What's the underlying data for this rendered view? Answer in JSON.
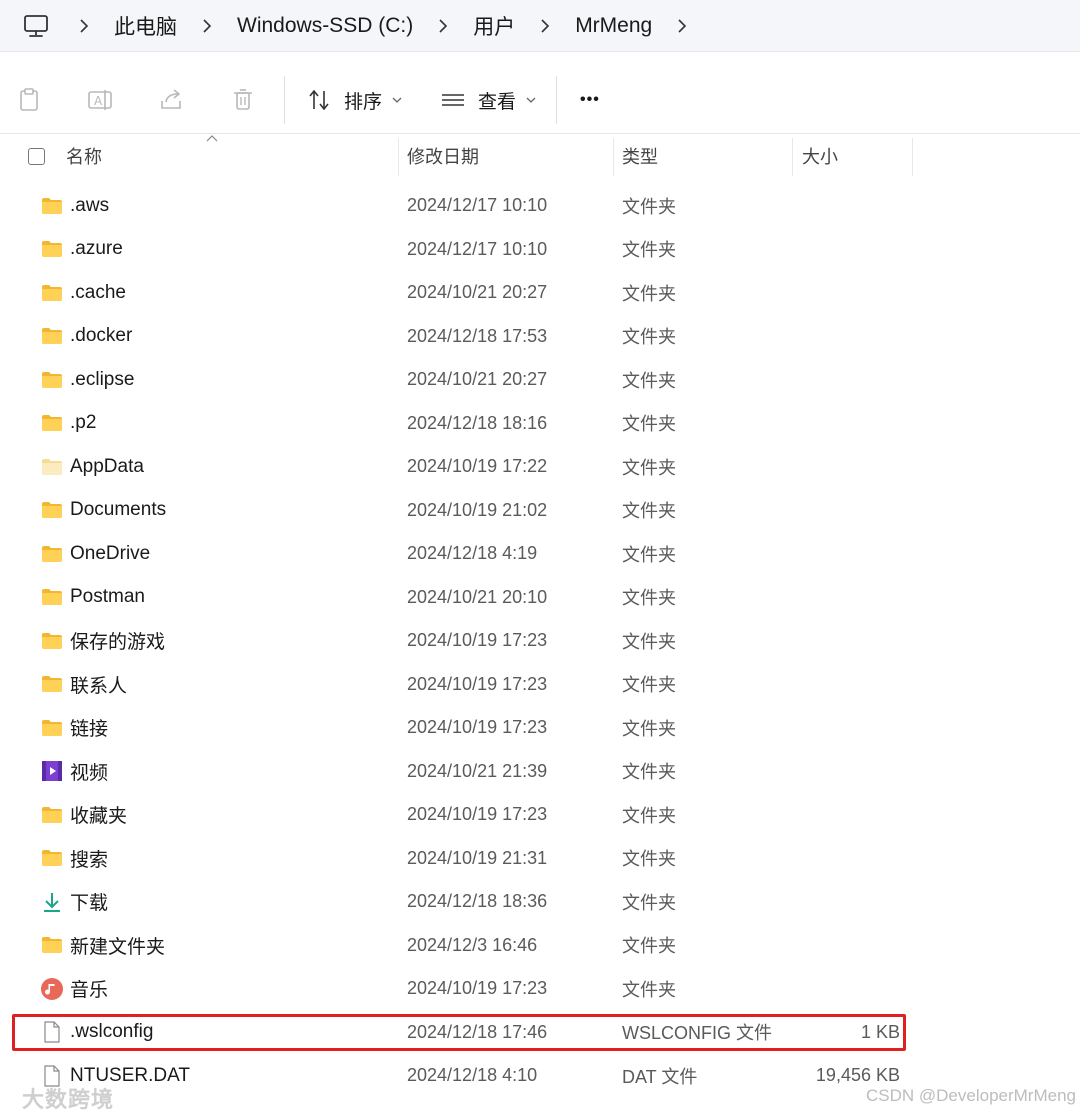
{
  "address": {
    "crumbs": [
      "此电脑",
      "Windows-SSD (C:)",
      "用户",
      "MrMeng"
    ]
  },
  "toolbar": {
    "sort_label": "排序",
    "view_label": "查看",
    "more_label": "•••"
  },
  "columns": {
    "name": "名称",
    "date": "修改日期",
    "type": "类型",
    "size": "大小"
  },
  "files": [
    {
      "name": ".aws",
      "date": "2024/12/17 10:10",
      "type": "文件夹",
      "size": "",
      "icon": "folder-icon"
    },
    {
      "name": ".azure",
      "date": "2024/12/17 10:10",
      "type": "文件夹",
      "size": "",
      "icon": "folder-icon"
    },
    {
      "name": ".cache",
      "date": "2024/10/21 20:27",
      "type": "文件夹",
      "size": "",
      "icon": "folder-icon"
    },
    {
      "name": ".docker",
      "date": "2024/12/18 17:53",
      "type": "文件夹",
      "size": "",
      "icon": "folder-icon"
    },
    {
      "name": ".eclipse",
      "date": "2024/10/21 20:27",
      "type": "文件夹",
      "size": "",
      "icon": "folder-icon"
    },
    {
      "name": ".p2",
      "date": "2024/12/18 18:16",
      "type": "文件夹",
      "size": "",
      "icon": "folder-icon"
    },
    {
      "name": "AppData",
      "date": "2024/10/19 17:22",
      "type": "文件夹",
      "size": "",
      "icon": "hidden-folder-icon"
    },
    {
      "name": "Documents",
      "date": "2024/10/19 21:02",
      "type": "文件夹",
      "size": "",
      "icon": "folder-icon"
    },
    {
      "name": "OneDrive",
      "date": "2024/12/18 4:19",
      "type": "文件夹",
      "size": "",
      "icon": "folder-icon"
    },
    {
      "name": "Postman",
      "date": "2024/10/21 20:10",
      "type": "文件夹",
      "size": "",
      "icon": "folder-icon"
    },
    {
      "name": "保存的游戏",
      "date": "2024/10/19 17:23",
      "type": "文件夹",
      "size": "",
      "icon": "folder-icon"
    },
    {
      "name": "联系人",
      "date": "2024/10/19 17:23",
      "type": "文件夹",
      "size": "",
      "icon": "folder-icon"
    },
    {
      "name": "链接",
      "date": "2024/10/19 17:23",
      "type": "文件夹",
      "size": "",
      "icon": "folder-icon"
    },
    {
      "name": "视频",
      "date": "2024/10/21 21:39",
      "type": "文件夹",
      "size": "",
      "icon": "video-icon"
    },
    {
      "name": "收藏夹",
      "date": "2024/10/19 17:23",
      "type": "文件夹",
      "size": "",
      "icon": "folder-icon"
    },
    {
      "name": "搜索",
      "date": "2024/10/19 21:31",
      "type": "文件夹",
      "size": "",
      "icon": "folder-icon"
    },
    {
      "name": "下载",
      "date": "2024/12/18 18:36",
      "type": "文件夹",
      "size": "",
      "icon": "download-icon"
    },
    {
      "name": "新建文件夹",
      "date": "2024/12/3 16:46",
      "type": "文件夹",
      "size": "",
      "icon": "folder-icon"
    },
    {
      "name": "音乐",
      "date": "2024/10/19 17:23",
      "type": "文件夹",
      "size": "",
      "icon": "music-icon"
    },
    {
      "name": ".wslconfig",
      "date": "2024/12/18 17:46",
      "type": "WSLCONFIG 文件",
      "size": "1 KB",
      "icon": "file-icon"
    },
    {
      "name": "NTUSER.DAT",
      "date": "2024/12/18 4:10",
      "type": "DAT 文件",
      "size": "19,456 KB",
      "icon": "file-icon"
    }
  ],
  "watermarks": {
    "left": "大数跨境",
    "right": "CSDN @DeveloperMrMeng"
  },
  "colors": {
    "folder": "#f7c948",
    "highlight": "#e02020",
    "accent": "#0067c0"
  }
}
